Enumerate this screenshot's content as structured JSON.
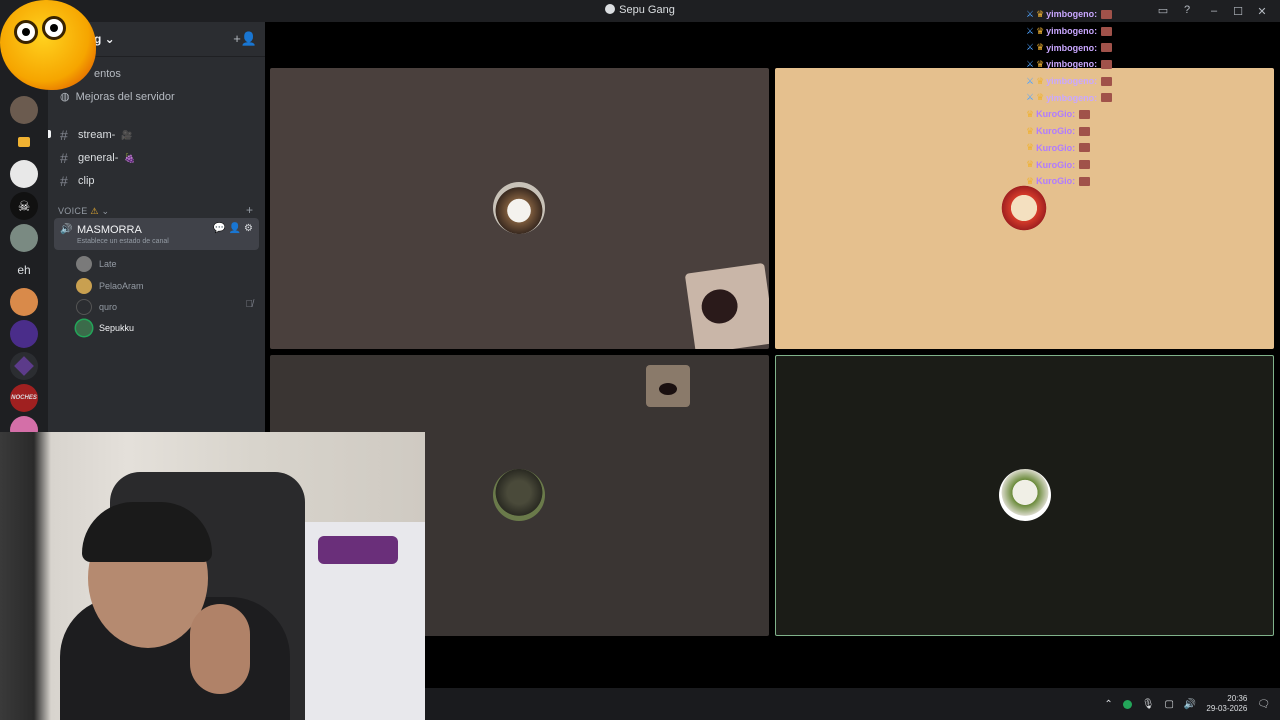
{
  "window": {
    "title": "Sepu Gang",
    "controls": {
      "minimize": "–",
      "maximize": "☐",
      "close": "✕"
    },
    "toolbar_icons": {
      "inbox": "▭",
      "help": "?"
    }
  },
  "server": {
    "name_partial": "g",
    "invite_icon": "+👤"
  },
  "sidebar": {
    "events_label": "entos",
    "boosts_label": "Mejoras del servidor",
    "channels": [
      {
        "name": "stream-",
        "emoji": "🎥"
      },
      {
        "name": "general-",
        "emoji": "🍇"
      },
      {
        "name": "clip",
        "emoji": ""
      }
    ],
    "voice_category": "VOICE",
    "voice_channel": {
      "name": "MASMORRA",
      "status": "Establece un estado de canal"
    },
    "members": [
      "Late",
      "PelaoAram",
      "quro",
      "Sepukku"
    ]
  },
  "guilds": {
    "text_guild": "eh",
    "noches_label": "NOCHES"
  },
  "chat": {
    "lines": [
      {
        "user": "yimbogeno:",
        "color": "#c9a7ff"
      },
      {
        "user": "yimbogeno:",
        "color": "#c9a7ff"
      },
      {
        "user": "yimbogeno:",
        "color": "#c9a7ff"
      },
      {
        "user": "yimbogeno:",
        "color": "#c9a7ff"
      },
      {
        "user": "yimbogeno:",
        "color": "#c9a7ff"
      },
      {
        "user": "yimbogeno:",
        "color": "#c9a7ff"
      },
      {
        "user": "KuroGio:",
        "color": "#b07cff"
      },
      {
        "user": "KuroGio:",
        "color": "#b07cff"
      },
      {
        "user": "KuroGio:",
        "color": "#b07cff"
      },
      {
        "user": "KuroGio:",
        "color": "#b07cff"
      },
      {
        "user": "KuroGio:",
        "color": "#b07cff"
      }
    ]
  },
  "taskbar": {
    "time": "20:36",
    "date": "29-03-2026"
  },
  "colors": {
    "tile_brown": "#4a403d",
    "tile_tan": "#e5c08e",
    "tile_dark": "#3a3533",
    "tile_speaking": "#1b1c17",
    "speaking_border": "#80b28b"
  }
}
